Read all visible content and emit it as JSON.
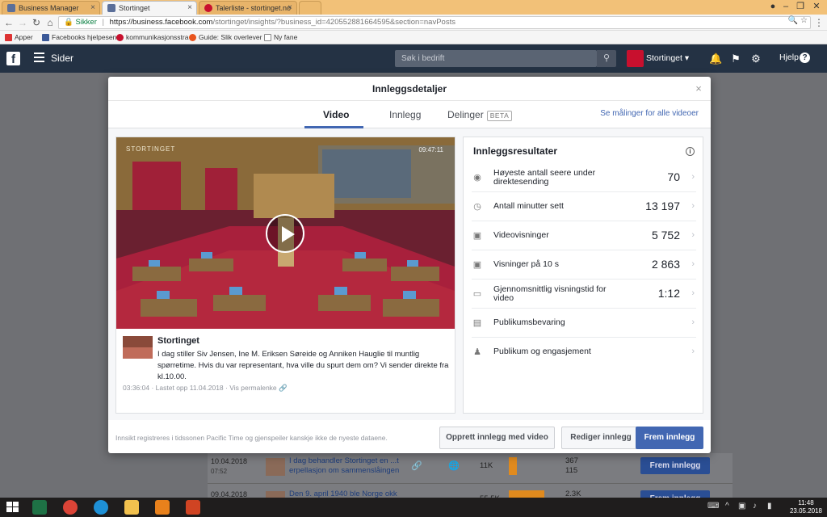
{
  "browser": {
    "tabs": [
      {
        "title": "Business Manager",
        "active": false
      },
      {
        "title": "Stortinget",
        "active": true
      },
      {
        "title": "Talerliste - stortinget.no",
        "active": false
      }
    ],
    "security_label": "Sikker",
    "url_host": "https://business.facebook.com",
    "url_path": "/stortinget/insights/?business_id=420552881664595&section=navPosts",
    "bookmarks": [
      "Apper",
      "Facebooks hjelpesen",
      "kommunikasjonsstra",
      "Guide: Slik overlever",
      "Ny fane"
    ]
  },
  "fb_header": {
    "logo": "f",
    "pages_label": "Sider",
    "search_placeholder": "Søk i bedrift",
    "page_name": "Stortinget",
    "help_label": "Hjelp",
    "help_icon": "?"
  },
  "background_rows": [
    {
      "date": "10.04.2018",
      "time": "07:52",
      "text": "I dag behandler Stortinget en ...t erpellasjon om sammenslåingen",
      "reach": "11K",
      "engagement_top": "367",
      "engagement_bottom": "115",
      "boost": "Frem innlegg"
    },
    {
      "date": "09.04.2018",
      "time": "",
      "text": "Den 9. april 1940 ble Norge okk",
      "reach": "55.5K",
      "engagement_top": "2.3K",
      "engagement_bottom": "",
      "boost": "Frem innlegg"
    }
  ],
  "modal": {
    "title": "Innleggsdetaljer",
    "close": "×",
    "tabs": [
      "Video",
      "Innlegg",
      "Delinger"
    ],
    "beta_badge": "BETA",
    "see_all_link": "Se målinger for alle videoer",
    "video": {
      "watermark": "STORTINGET",
      "timestamp": "09:47:11"
    },
    "post": {
      "author": "Stortinget",
      "text": "I dag stiller Siv Jensen, Ine M. Eriksen Søreide og Anniken Hauglie til muntlig spørretime. Hvis du var representant, hva ville du spurt dem om? Vi sender direkte fra kl.10.00.",
      "duration": "03:36:04",
      "uploaded": "Lastet opp 11.04.2018",
      "permalink": "Vis permalenke"
    },
    "results": {
      "title": "Innleggsresultater",
      "info_icon": "i",
      "rows": [
        {
          "label": "Høyeste antall seere under direktesending",
          "value": "70",
          "icon": "eye-icon"
        },
        {
          "label": "Antall minutter sett",
          "value": "13 197",
          "icon": "clock-icon"
        },
        {
          "label": "Videovisninger",
          "value": "5 752",
          "icon": "video-camera-icon"
        },
        {
          "label": "Visninger på 10 s",
          "value": "2 863",
          "icon": "video-camera-icon"
        },
        {
          "label": "Gjennomsnittlig visningstid for video",
          "value": "1:12",
          "icon": "video-frame-icon"
        },
        {
          "label": "Publikumsbevaring",
          "value": "",
          "icon": "film-icon"
        },
        {
          "label": "Publikum og engasjement",
          "value": "",
          "icon": "people-icon"
        }
      ]
    },
    "footer_note": "Innsikt registreres i tidssonen Pacific Time og gjenspeiler kanskje ikke de nyeste dataene.",
    "buttons": {
      "create": "Opprett innlegg med video",
      "edit": "Rediger innlegg",
      "boost": "Frem innlegg"
    }
  },
  "taskbar": {
    "time": "11:48",
    "date": "23.05.2018"
  },
  "colors": {
    "fb_blue": "#4267b2",
    "header_dark": "#243244",
    "tab_bar": "#f2c178"
  }
}
